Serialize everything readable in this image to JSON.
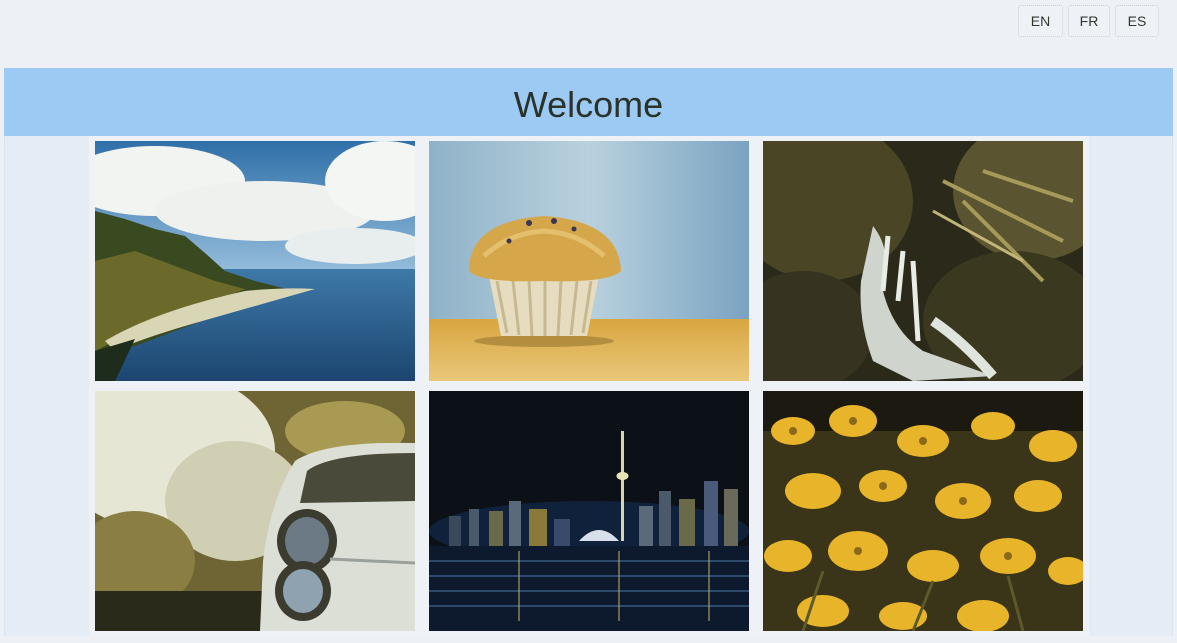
{
  "language_buttons": [
    {
      "label": "EN"
    },
    {
      "label": "FR"
    },
    {
      "label": "ES"
    }
  ],
  "header": {
    "title": "Welcome"
  },
  "gallery": {
    "photos": [
      {
        "subject": "coastline"
      },
      {
        "subject": "muffin"
      },
      {
        "subject": "waterfall"
      },
      {
        "subject": "vintage-car"
      },
      {
        "subject": "city-skyline-night"
      },
      {
        "subject": "yellow-flowers"
      }
    ]
  },
  "colors": {
    "page_background": "#edf1f5",
    "header_background": "#9ccaf3",
    "title_text": "#2a322a"
  }
}
